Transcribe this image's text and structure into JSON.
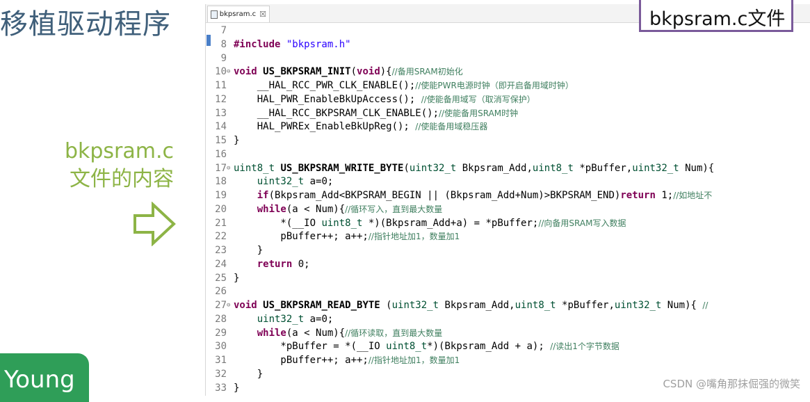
{
  "slide": {
    "title": "移植驱动程序",
    "caption_line1": "bkpsram.c",
    "caption_line2": "文件的内容",
    "badge": "Young",
    "file_label": "bkpsram.c文件",
    "watermark": "CSDN @嘴角那抹倔强的微笑"
  },
  "editor": {
    "tab_label": "bkpsram.c",
    "tab_close": "☒",
    "lines": [
      {
        "n": "7",
        "fold": "",
        "parts": []
      },
      {
        "n": "8",
        "fold": "",
        "parts": [
          {
            "t": "#include ",
            "c": "kw"
          },
          {
            "t": "\"bkpsram.h\"",
            "c": "st"
          }
        ]
      },
      {
        "n": "9",
        "fold": "",
        "parts": []
      },
      {
        "n": "10",
        "fold": "⊖",
        "parts": [
          {
            "t": "void ",
            "c": "kw"
          },
          {
            "t": "US_BKPSRAM_INIT",
            "c": "fn"
          },
          {
            "t": "(",
            "c": ""
          },
          {
            "t": "void",
            "c": "kw"
          },
          {
            "t": "){",
            "c": ""
          },
          {
            "t": "//备用SRAM初始化",
            "c": "cm"
          }
        ]
      },
      {
        "n": "11",
        "fold": "",
        "parts": [
          {
            "t": "    __HAL_RCC_PWR_CLK_ENABLE();",
            "c": ""
          },
          {
            "t": "//使能PWR电源时钟（即开启备用域时钟）",
            "c": "cm"
          }
        ]
      },
      {
        "n": "12",
        "fold": "",
        "parts": [
          {
            "t": "    HAL_PWR_EnableBkUpAccess(); ",
            "c": ""
          },
          {
            "t": "//使能备用域写（取消写保护）",
            "c": "cm"
          }
        ]
      },
      {
        "n": "13",
        "fold": "",
        "parts": [
          {
            "t": "    __HAL_RCC_BKPSRAM_CLK_ENABLE();",
            "c": ""
          },
          {
            "t": "//使能备用SRAM时钟",
            "c": "cm"
          }
        ]
      },
      {
        "n": "14",
        "fold": "",
        "parts": [
          {
            "t": "    HAL_PWREx_EnableBkUpReg(); ",
            "c": ""
          },
          {
            "t": "//使能备用域稳压器",
            "c": "cm"
          }
        ]
      },
      {
        "n": "15",
        "fold": "",
        "parts": [
          {
            "t": "}",
            "c": ""
          }
        ]
      },
      {
        "n": "16",
        "fold": "",
        "parts": []
      },
      {
        "n": "17",
        "fold": "⊖",
        "parts": [
          {
            "t": "uint8_t ",
            "c": "ty"
          },
          {
            "t": "US_BKPSRAM_WRITE_BYTE",
            "c": "fn"
          },
          {
            "t": "(",
            "c": ""
          },
          {
            "t": "uint32_t",
            "c": "ty"
          },
          {
            "t": " Bkpsram_Add,",
            "c": ""
          },
          {
            "t": "uint8_t",
            "c": "ty"
          },
          {
            "t": " *pBuffer,",
            "c": ""
          },
          {
            "t": "uint32_t",
            "c": "ty"
          },
          {
            "t": " Num){",
            "c": ""
          }
        ]
      },
      {
        "n": "18",
        "fold": "",
        "parts": [
          {
            "t": "    ",
            "c": ""
          },
          {
            "t": "uint32_t",
            "c": "ty"
          },
          {
            "t": " a=0;",
            "c": ""
          }
        ]
      },
      {
        "n": "19",
        "fold": "",
        "parts": [
          {
            "t": "    ",
            "c": ""
          },
          {
            "t": "if",
            "c": "kw"
          },
          {
            "t": "(Bkpsram_Add<BKPSRAM_BEGIN || (Bkpsram_Add+Num)>BKPSRAM_END)",
            "c": ""
          },
          {
            "t": "return",
            "c": "kw"
          },
          {
            "t": " 1;",
            "c": ""
          },
          {
            "t": "//如地址不",
            "c": "cm"
          }
        ]
      },
      {
        "n": "20",
        "fold": "",
        "parts": [
          {
            "t": "    ",
            "c": ""
          },
          {
            "t": "while",
            "c": "kw"
          },
          {
            "t": "(a < Num){",
            "c": ""
          },
          {
            "t": "//循环写入，直到最大数量",
            "c": "cm"
          }
        ]
      },
      {
        "n": "21",
        "fold": "",
        "parts": [
          {
            "t": "        *(__IO ",
            "c": ""
          },
          {
            "t": "uint8_t",
            "c": "ty"
          },
          {
            "t": " *)(Bkpsram_Add+a) = *pBuffer;",
            "c": ""
          },
          {
            "t": "//向备用SRAM写入数据",
            "c": "cm"
          }
        ]
      },
      {
        "n": "22",
        "fold": "",
        "parts": [
          {
            "t": "        pBuffer++; a++;",
            "c": ""
          },
          {
            "t": "//指针地址加1，数量加1",
            "c": "cm"
          }
        ]
      },
      {
        "n": "23",
        "fold": "",
        "parts": [
          {
            "t": "    }",
            "c": ""
          }
        ]
      },
      {
        "n": "24",
        "fold": "",
        "parts": [
          {
            "t": "    ",
            "c": ""
          },
          {
            "t": "return",
            "c": "kw"
          },
          {
            "t": " 0;",
            "c": ""
          }
        ]
      },
      {
        "n": "25",
        "fold": "",
        "parts": [
          {
            "t": "}",
            "c": ""
          }
        ]
      },
      {
        "n": "26",
        "fold": "",
        "parts": []
      },
      {
        "n": "27",
        "fold": "⊖",
        "parts": [
          {
            "t": "void ",
            "c": "kw"
          },
          {
            "t": "US_BKPSRAM_READ_BYTE",
            "c": "fn"
          },
          {
            "t": " (",
            "c": ""
          },
          {
            "t": "uint32_t",
            "c": "ty"
          },
          {
            "t": " Bkpsram_Add,",
            "c": ""
          },
          {
            "t": "uint8_t",
            "c": "ty"
          },
          {
            "t": " *pBuffer,",
            "c": ""
          },
          {
            "t": "uint32_t",
            "c": "ty"
          },
          {
            "t": " Num){ ",
            "c": ""
          },
          {
            "t": "//",
            "c": "cm"
          }
        ]
      },
      {
        "n": "28",
        "fold": "",
        "parts": [
          {
            "t": "    ",
            "c": ""
          },
          {
            "t": "uint32_t",
            "c": "ty"
          },
          {
            "t": " a=0;",
            "c": ""
          }
        ]
      },
      {
        "n": "29",
        "fold": "",
        "parts": [
          {
            "t": "    ",
            "c": ""
          },
          {
            "t": "while",
            "c": "kw"
          },
          {
            "t": "(a < Num){",
            "c": ""
          },
          {
            "t": "//循环读取，直到最大数量",
            "c": "cm"
          }
        ]
      },
      {
        "n": "30",
        "fold": "",
        "parts": [
          {
            "t": "        *pBuffer = *(__IO ",
            "c": ""
          },
          {
            "t": "uint8_t",
            "c": "ty"
          },
          {
            "t": "*)(Bkpsram_Add + a); ",
            "c": ""
          },
          {
            "t": "//读出1个字节数据",
            "c": "cm"
          }
        ]
      },
      {
        "n": "31",
        "fold": "",
        "parts": [
          {
            "t": "        pBuffer++; a++;",
            "c": ""
          },
          {
            "t": "//指针地址加1，数量加1",
            "c": "cm"
          }
        ]
      },
      {
        "n": "32",
        "fold": "",
        "parts": [
          {
            "t": "    }",
            "c": ""
          }
        ]
      },
      {
        "n": "33",
        "fold": "",
        "parts": [
          {
            "t": "}",
            "c": ""
          }
        ]
      }
    ]
  },
  "colors": {
    "title": "#3f5f7a",
    "caption": "#8db446",
    "badge": "#2f9e58",
    "keyword": "#7f0055",
    "type": "#005032",
    "string": "#2a00ff",
    "comment": "#3f7f5f",
    "frame": "#7a5a9a"
  },
  "icons": {
    "arrow": "hollow-right-arrow-icon",
    "file": "c-file-icon",
    "close": "close-icon"
  }
}
